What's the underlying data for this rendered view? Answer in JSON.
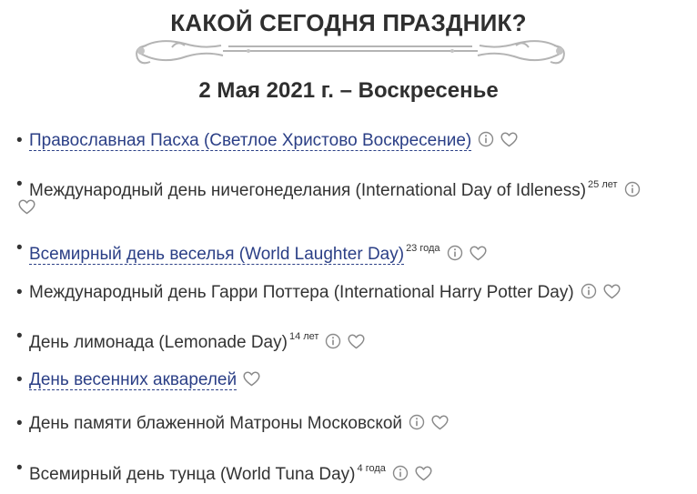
{
  "header": {
    "title": "КАКОЙ СЕГОДНЯ ПРАЗДНИК?"
  },
  "date_heading": "2 Мая 2021 г. – Воскресенье",
  "holidays": [
    {
      "name": "Православная Пасха (Светлое Христово Воскресение)",
      "years": "",
      "is_link": true,
      "has_info": true,
      "has_heart": true
    },
    {
      "name": "Международный день ничегонеделания (International Day of Idleness)",
      "years": "25 лет",
      "is_link": false,
      "has_info": true,
      "has_heart": true
    },
    {
      "name": "Всемирный день веселья (World Laughter Day)",
      "years": "23 года",
      "is_link": true,
      "has_info": true,
      "has_heart": true
    },
    {
      "name": "Международный день Гарри Поттера (International Harry Potter Day)",
      "years": "",
      "is_link": false,
      "has_info": true,
      "has_heart": true
    },
    {
      "name": "День лимонада (Lemonade Day)",
      "years": "14 лет",
      "is_link": false,
      "has_info": true,
      "has_heart": true
    },
    {
      "name": "День весенних акварелей",
      "years": "",
      "is_link": true,
      "has_info": false,
      "has_heart": true
    },
    {
      "name": "День памяти блаженной Матроны Московской",
      "years": "",
      "is_link": false,
      "has_info": true,
      "has_heart": true
    },
    {
      "name": "Всемирный день тунца (World Tuna Day)",
      "years": "4 года",
      "is_link": false,
      "has_info": true,
      "has_heart": true
    }
  ],
  "bullet": "•",
  "icons": {
    "info": "info-icon",
    "favorite": "heart-icon",
    "ornament": "ornament-divider"
  },
  "colors": {
    "link": "#2b3f86",
    "text": "#333333",
    "icon": "#8a8a8a"
  }
}
